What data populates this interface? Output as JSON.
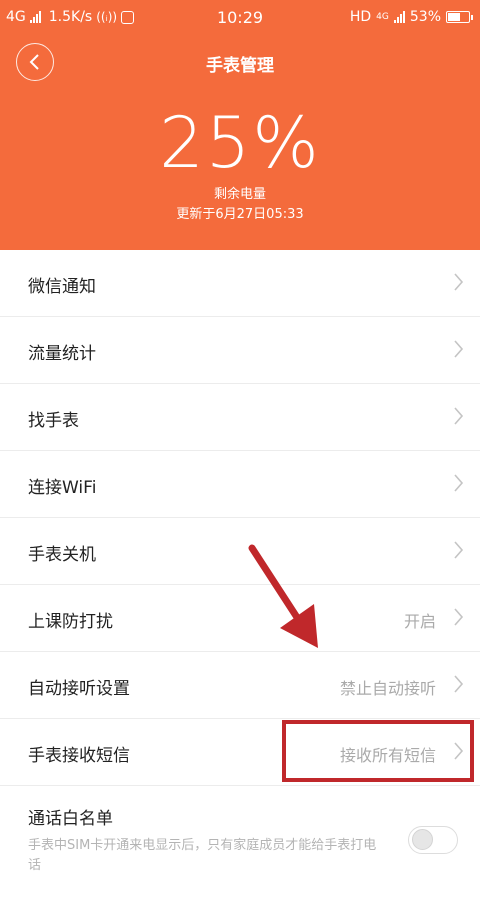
{
  "status_bar": {
    "network": "4G",
    "speed": "1.5K/s",
    "time": "10:29",
    "hd": "HD",
    "net_right": "4G",
    "battery": "53%"
  },
  "header": {
    "title": "手表管理",
    "battery_percent": "25%",
    "battery_label": "剩余电量",
    "updated": "更新于6月27日05:33"
  },
  "menu": [
    {
      "label": "微信通知",
      "value": ""
    },
    {
      "label": "流量统计",
      "value": ""
    },
    {
      "label": "找手表",
      "value": ""
    },
    {
      "label": "连接WiFi",
      "value": ""
    },
    {
      "label": "手表关机",
      "value": ""
    },
    {
      "label": "上课防打扰",
      "value": "开启"
    },
    {
      "label": "自动接听设置",
      "value": "禁止自动接听"
    },
    {
      "label": "手表接收短信",
      "value": "接收所有短信"
    }
  ],
  "whitelist": {
    "label": "通话白名单",
    "description": "手表中SIM卡开通来电显示后，只有家庭成员才能给手表打电话",
    "enabled": false
  },
  "colors": {
    "header_bg": "#f46b3c",
    "annotation": "#c0282b"
  }
}
